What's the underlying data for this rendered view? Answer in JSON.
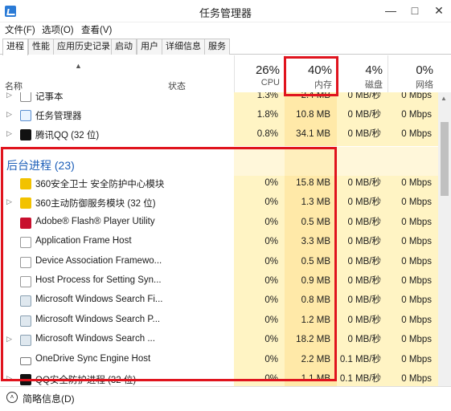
{
  "window": {
    "title": "任务管理器",
    "min": "—",
    "max": "□",
    "close": "✕"
  },
  "menu": [
    "文件(F)",
    "选项(O)",
    "查看(V)"
  ],
  "tabs": [
    "进程",
    "性能",
    "应用历史记录",
    "启动",
    "用户",
    "详细信息",
    "服务"
  ],
  "header": {
    "sort_indicator": "▲",
    "name": "名称",
    "status": "状态",
    "cpu": {
      "pct": "26%",
      "label": "CPU"
    },
    "memory": {
      "pct": "40%",
      "label": "内存"
    },
    "disk": {
      "pct": "4%",
      "label": "磁盘"
    },
    "network": {
      "pct": "0%",
      "label": "网络"
    }
  },
  "apps": [
    {
      "name": "记事本",
      "cpu": "1.3%",
      "mem": "2.4 MB",
      "disk": "0 MB/秒",
      "net": "0 Mbps",
      "icon": "notepad-icon",
      "expandable": true
    },
    {
      "name": "任务管理器",
      "cpu": "1.8%",
      "mem": "10.8 MB",
      "disk": "0 MB/秒",
      "net": "0 Mbps",
      "icon": "task-manager-icon",
      "expandable": true
    },
    {
      "name": "腾讯QQ (32 位)",
      "cpu": "0.8%",
      "mem": "34.1 MB",
      "disk": "0 MB/秒",
      "net": "0 Mbps",
      "icon": "qq-icon",
      "expandable": true
    }
  ],
  "background_group": {
    "label": "后台进程 (23)"
  },
  "background": [
    {
      "name": "360安全卫士 安全防护中心模块...",
      "cpu": "0%",
      "mem": "15.8 MB",
      "disk": "0 MB/秒",
      "net": "0 Mbps",
      "icon": "360-icon",
      "expandable": false
    },
    {
      "name": "360主动防御服务模块 (32 位)",
      "cpu": "0%",
      "mem": "1.3 MB",
      "disk": "0 MB/秒",
      "net": "0 Mbps",
      "icon": "360-icon",
      "expandable": true
    },
    {
      "name": "Adobe® Flash® Player Utility",
      "cpu": "0%",
      "mem": "0.5 MB",
      "disk": "0 MB/秒",
      "net": "0 Mbps",
      "icon": "flash-icon",
      "expandable": false
    },
    {
      "name": "Application Frame Host",
      "cpu": "0%",
      "mem": "3.3 MB",
      "disk": "0 MB/秒",
      "net": "0 Mbps",
      "icon": "app-icon",
      "expandable": false
    },
    {
      "name": "Device Association Framewo...",
      "cpu": "0%",
      "mem": "0.5 MB",
      "disk": "0 MB/秒",
      "net": "0 Mbps",
      "icon": "app-icon",
      "expandable": false
    },
    {
      "name": "Host Process for Setting Syn...",
      "cpu": "0%",
      "mem": "0.9 MB",
      "disk": "0 MB/秒",
      "net": "0 Mbps",
      "icon": "app-icon",
      "expandable": false
    },
    {
      "name": "Microsoft Windows Search Fi...",
      "cpu": "0%",
      "mem": "0.8 MB",
      "disk": "0 MB/秒",
      "net": "0 Mbps",
      "icon": "search-icon",
      "expandable": false
    },
    {
      "name": "Microsoft Windows Search P...",
      "cpu": "0%",
      "mem": "1.2 MB",
      "disk": "0 MB/秒",
      "net": "0 Mbps",
      "icon": "search-icon",
      "expandable": false
    },
    {
      "name": "Microsoft Windows Search ...",
      "cpu": "0%",
      "mem": "18.2 MB",
      "disk": "0 MB/秒",
      "net": "0 Mbps",
      "icon": "search-icon",
      "expandable": true
    },
    {
      "name": "OneDrive Sync Engine Host",
      "cpu": "0%",
      "mem": "2.2 MB",
      "disk": "0.1 MB/秒",
      "net": "0 Mbps",
      "icon": "cloud-icon",
      "expandable": false
    },
    {
      "name": "QQ安全防护进程 (32 位)",
      "cpu": "0%",
      "mem": "1.1 MB",
      "disk": "0.1 MB/秒",
      "net": "0 Mbps",
      "icon": "qq-shield-icon",
      "expandable": true
    }
  ],
  "footer": {
    "label": "简略信息(D)",
    "toggle": "˄"
  }
}
